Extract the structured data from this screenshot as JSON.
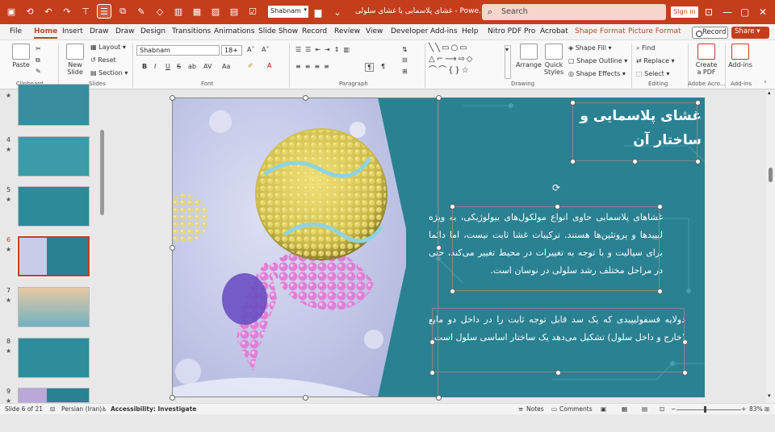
{
  "titlebar": {
    "font_name": "Shabnam",
    "doc_title": "غشای پلاسمایی یا غشای سلولی - Powe...",
    "search_placeholder": "Search",
    "signin_label": "Sign in",
    "icons": [
      "save-icon",
      "autosave-icon",
      "undo-icon",
      "redo-icon",
      "present-icon",
      "layout-icon",
      "copy-icon",
      "format-painter-icon",
      "shapes-icon",
      "chart-icon",
      "table-icon",
      "picture-icon",
      "textbox-icon",
      "checkbox-icon",
      "more-icon"
    ]
  },
  "menu": {
    "tabs": [
      "File",
      "Home",
      "Insert",
      "Draw",
      "Draw",
      "Design",
      "Transitions",
      "Animations",
      "Slide Show",
      "Record",
      "Review",
      "View",
      "Developer",
      "Add-ins",
      "Help",
      "Nitro PDF Pro",
      "Acrobat",
      "Shape Format",
      "Picture Format"
    ],
    "active": "Home",
    "record_label": "Record",
    "share_label": "Share"
  },
  "ribbon": {
    "clipboard": {
      "label": "Clipboard",
      "paste": "Paste"
    },
    "slides": {
      "label": "Slides",
      "new_slide": "New Slide",
      "layout": "Layout",
      "reset": "Reset",
      "section": "Section"
    },
    "font": {
      "label": "Font",
      "name": "Shabnam",
      "size": "18+",
      "buttons": [
        "B",
        "I",
        "U",
        "S",
        "ab",
        "AV",
        "Aa"
      ]
    },
    "paragraph": {
      "label": "Paragraph"
    },
    "drawing": {
      "label": "Drawing",
      "arrange": "Arrange",
      "quick_styles": "Quick Styles",
      "shape_fill": "Shape Fill",
      "shape_outline": "Shape Outline",
      "shape_effects": "Shape Effects"
    },
    "editing": {
      "label": "Editing",
      "find": "Find",
      "replace": "Replace",
      "select": "Select"
    },
    "adobe": {
      "label": "Adobe Acro...",
      "create_pdf": "Create a PDF"
    },
    "addins": {
      "label": "Add-ins",
      "btn": "Add-ins"
    }
  },
  "thumbnails": [
    {
      "num": "",
      "star": "★"
    },
    {
      "num": "4",
      "star": "★"
    },
    {
      "num": "5",
      "star": "★"
    },
    {
      "num": "6",
      "star": "★"
    },
    {
      "num": "7",
      "star": "★"
    },
    {
      "num": "8",
      "star": "★"
    },
    {
      "num": "9",
      "star": "★"
    }
  ],
  "selected_slide": 6,
  "slide": {
    "title": "غشای پلاسمایی و ساختار آن",
    "paragraph1": "غشاهای پلاسمایی حاوی انواع مولکول‌های بیولوژیکی، به ویژه لیپیدها و پروتئین‌ها هستند. ترکیبات غشا ثابت نیست، اما دائما برای سیالیت و با توجه به تغییرات در محیط تغییر می‌کند، حتی در مراحل مختلف رشد سلولی در نوسان است.",
    "paragraph2": "دولایه فسفولیپیدی که یک سد قابل توجه ثابت را در داخل دو مایع (خارج و داخل سلول) تشکیل می‌دهد یک ساختار اساسی سلول است."
  },
  "status": {
    "slide_of": "Slide 6 of 21",
    "language": "Persian (Iran)",
    "accessibility": "Accessibility: Investigate",
    "notes": "Notes",
    "comments": "Comments",
    "zoom": "83%"
  },
  "colors": {
    "accent": "#c43e1c",
    "slide_bg": "#2a8192"
  }
}
